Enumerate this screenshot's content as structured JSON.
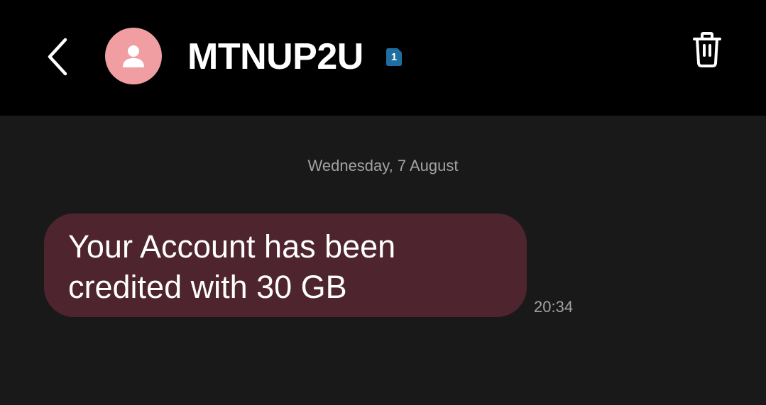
{
  "header": {
    "contact_name": "MTNUP2U",
    "sim_badge": "1",
    "back_icon": "chevron-left-icon",
    "avatar_icon": "person-icon",
    "delete_icon": "trash-icon"
  },
  "conversation": {
    "date_separator": "Wednesday, 7 August",
    "messages": [
      {
        "text": "Your Account has been credited with 30 GB",
        "time": "20:34",
        "direction": "incoming"
      }
    ]
  },
  "colors": {
    "header_background": "#000000",
    "conversation_background": "#191919",
    "avatar_background": "#f19ea3",
    "incoming_bubble": "#4e242e",
    "sim_badge": "#1e6fa0",
    "secondary_text": "#a2a2a2"
  }
}
